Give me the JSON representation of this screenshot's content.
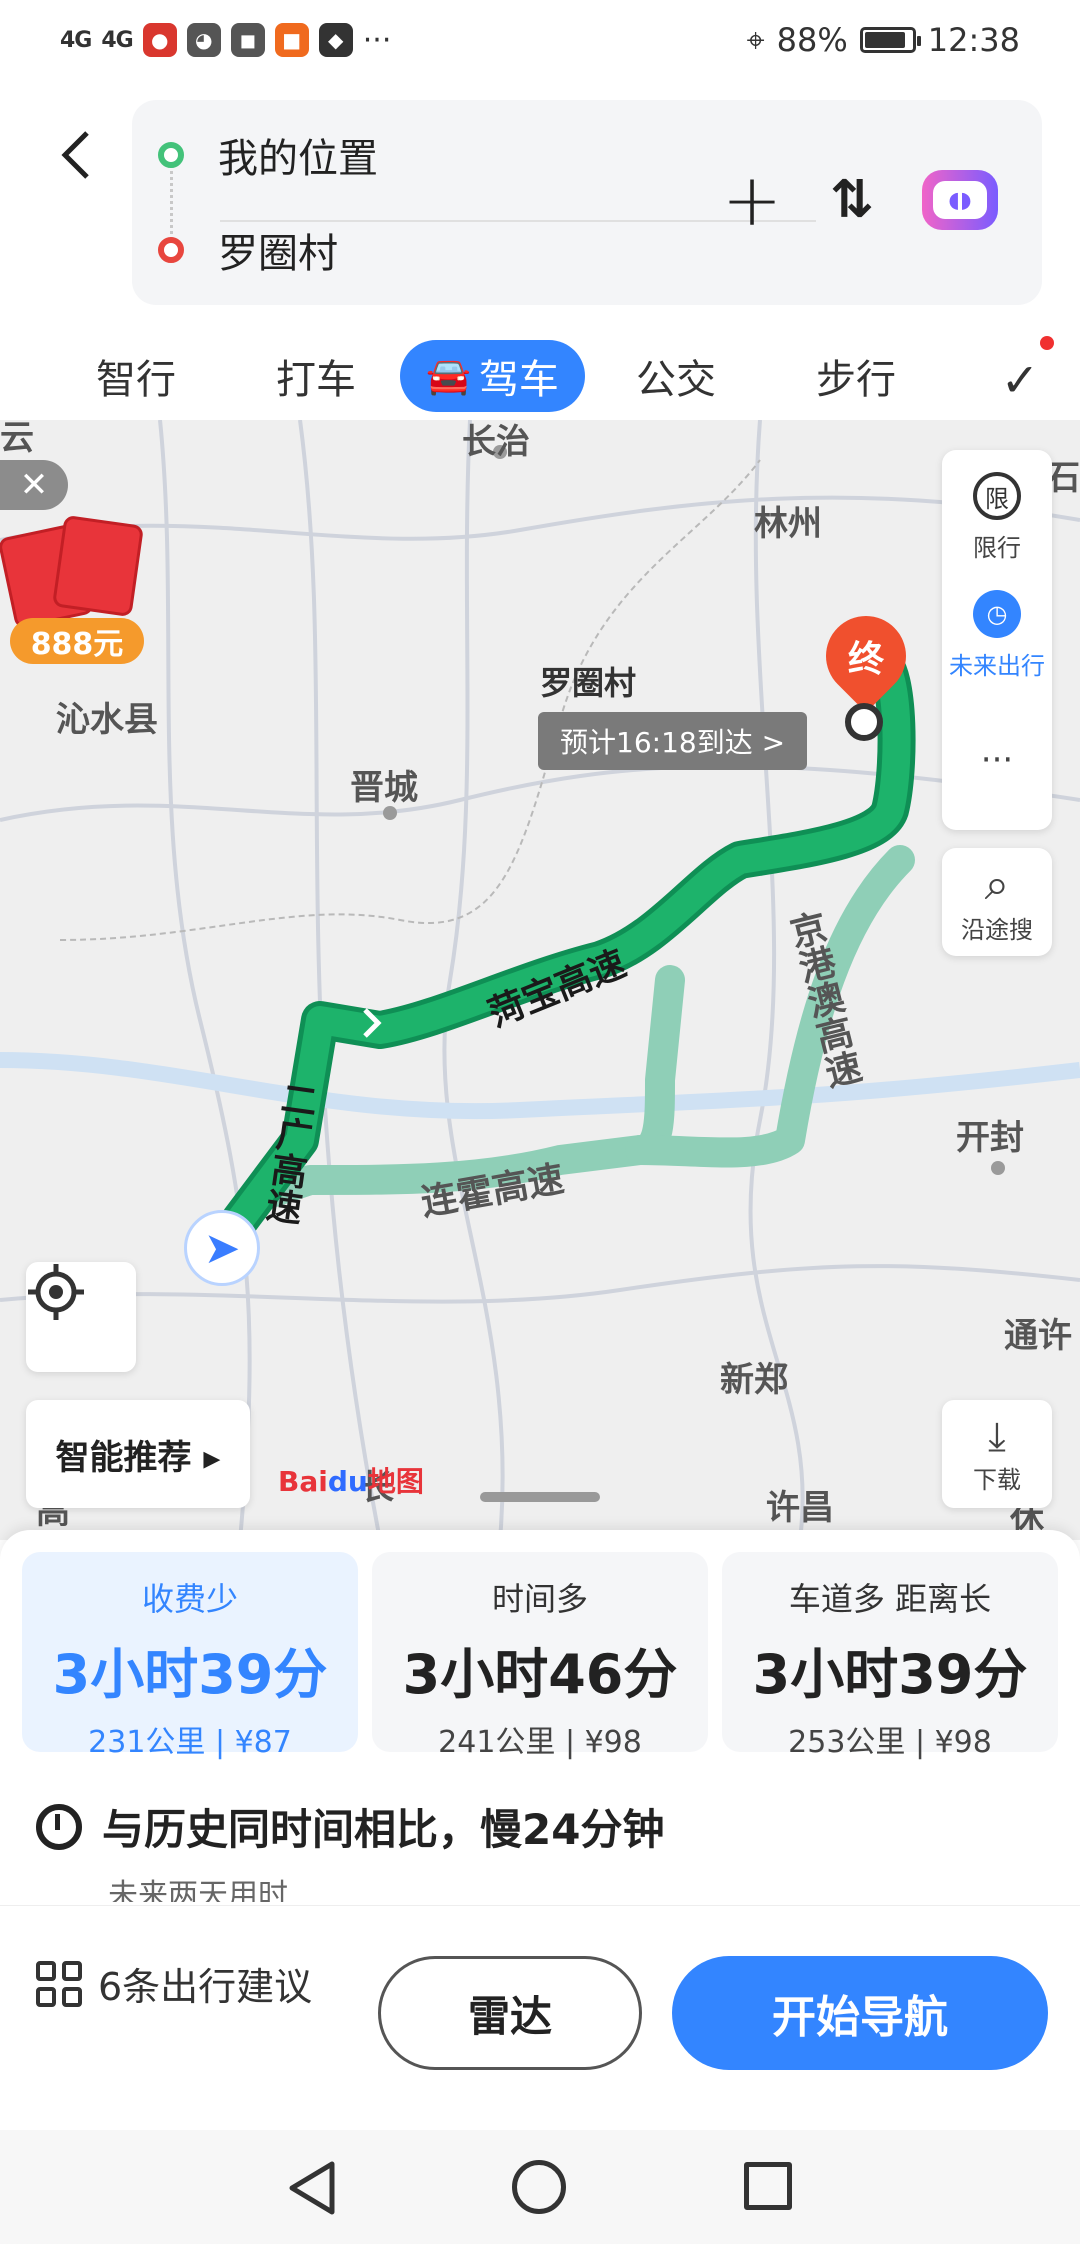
{
  "status_bar": {
    "signal1": "4G",
    "signal2": "4G",
    "more": "···",
    "battery": "88%",
    "time": "12:38"
  },
  "header": {
    "origin": "我的位置",
    "destination": "罗圈村"
  },
  "tabs": [
    "智行",
    "打车",
    "驾车",
    "公交",
    "步行"
  ],
  "active_tab": "驾车",
  "map": {
    "cities": [
      "长治",
      "林州",
      "沁水县",
      "晋城",
      "开封",
      "新郑",
      "许昌",
      "通许",
      "云",
      "石",
      "高",
      "长",
      "休"
    ],
    "destination_label": "罗圈村",
    "end_marker": "终",
    "eta": "预计16:18到达 >",
    "roads": {
      "main": "菏宝高速",
      "g2": "二广高速",
      "alt1": "连霍高速",
      "alt2": "京港澳高速"
    },
    "redpack": "888元",
    "side": {
      "restrict_icon": "限",
      "restrict": "限行",
      "future": "未来出行",
      "more": "···",
      "search": "沿途搜",
      "download": "下载"
    },
    "smart_recommend": "智能推荐 ▸",
    "baidu_logo_a": "Bai",
    "baidu_logo_b": "du",
    "baidu_logo_c": "地图"
  },
  "routes": [
    {
      "tag": "收费少",
      "time": "3小时39分",
      "distance": "231公里",
      "fee": "¥87"
    },
    {
      "tag": "时间多",
      "time": "3小时46分",
      "distance": "241公里",
      "fee": "¥98"
    },
    {
      "tag": "车道多 距离长",
      "time": "3小时39分",
      "distance": "253公里",
      "fee": "¥98"
    }
  ],
  "history_note": "与历史同时间相比，慢24分钟",
  "future_note": "未来两天用时",
  "actions": {
    "suggest": "6条出行建议",
    "radar": "雷达",
    "start": "开始导航"
  },
  "colors": {
    "accent": "#3385ff",
    "route_main": "#1db36b",
    "route_alt": "#8fcfb7",
    "end_marker": "#f0502e"
  }
}
